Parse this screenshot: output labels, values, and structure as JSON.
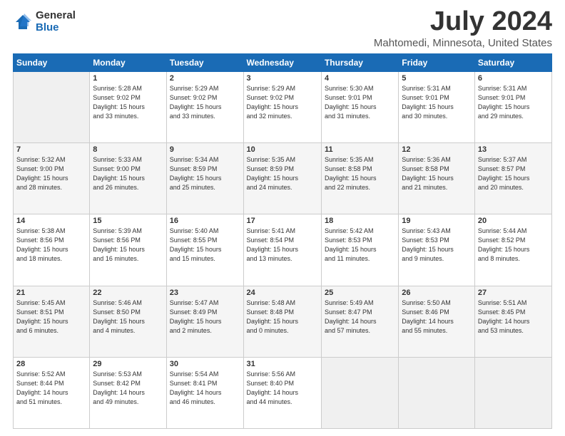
{
  "header": {
    "logo_general": "General",
    "logo_blue": "Blue",
    "month_title": "July 2024",
    "location": "Mahtomedi, Minnesota, United States"
  },
  "days_of_week": [
    "Sunday",
    "Monday",
    "Tuesday",
    "Wednesday",
    "Thursday",
    "Friday",
    "Saturday"
  ],
  "weeks": [
    [
      {
        "num": "",
        "info": ""
      },
      {
        "num": "1",
        "info": "Sunrise: 5:28 AM\nSunset: 9:02 PM\nDaylight: 15 hours\nand 33 minutes."
      },
      {
        "num": "2",
        "info": "Sunrise: 5:29 AM\nSunset: 9:02 PM\nDaylight: 15 hours\nand 33 minutes."
      },
      {
        "num": "3",
        "info": "Sunrise: 5:29 AM\nSunset: 9:02 PM\nDaylight: 15 hours\nand 32 minutes."
      },
      {
        "num": "4",
        "info": "Sunrise: 5:30 AM\nSunset: 9:01 PM\nDaylight: 15 hours\nand 31 minutes."
      },
      {
        "num": "5",
        "info": "Sunrise: 5:31 AM\nSunset: 9:01 PM\nDaylight: 15 hours\nand 30 minutes."
      },
      {
        "num": "6",
        "info": "Sunrise: 5:31 AM\nSunset: 9:01 PM\nDaylight: 15 hours\nand 29 minutes."
      }
    ],
    [
      {
        "num": "7",
        "info": "Sunrise: 5:32 AM\nSunset: 9:00 PM\nDaylight: 15 hours\nand 28 minutes."
      },
      {
        "num": "8",
        "info": "Sunrise: 5:33 AM\nSunset: 9:00 PM\nDaylight: 15 hours\nand 26 minutes."
      },
      {
        "num": "9",
        "info": "Sunrise: 5:34 AM\nSunset: 8:59 PM\nDaylight: 15 hours\nand 25 minutes."
      },
      {
        "num": "10",
        "info": "Sunrise: 5:35 AM\nSunset: 8:59 PM\nDaylight: 15 hours\nand 24 minutes."
      },
      {
        "num": "11",
        "info": "Sunrise: 5:35 AM\nSunset: 8:58 PM\nDaylight: 15 hours\nand 22 minutes."
      },
      {
        "num": "12",
        "info": "Sunrise: 5:36 AM\nSunset: 8:58 PM\nDaylight: 15 hours\nand 21 minutes."
      },
      {
        "num": "13",
        "info": "Sunrise: 5:37 AM\nSunset: 8:57 PM\nDaylight: 15 hours\nand 20 minutes."
      }
    ],
    [
      {
        "num": "14",
        "info": "Sunrise: 5:38 AM\nSunset: 8:56 PM\nDaylight: 15 hours\nand 18 minutes."
      },
      {
        "num": "15",
        "info": "Sunrise: 5:39 AM\nSunset: 8:56 PM\nDaylight: 15 hours\nand 16 minutes."
      },
      {
        "num": "16",
        "info": "Sunrise: 5:40 AM\nSunset: 8:55 PM\nDaylight: 15 hours\nand 15 minutes."
      },
      {
        "num": "17",
        "info": "Sunrise: 5:41 AM\nSunset: 8:54 PM\nDaylight: 15 hours\nand 13 minutes."
      },
      {
        "num": "18",
        "info": "Sunrise: 5:42 AM\nSunset: 8:53 PM\nDaylight: 15 hours\nand 11 minutes."
      },
      {
        "num": "19",
        "info": "Sunrise: 5:43 AM\nSunset: 8:53 PM\nDaylight: 15 hours\nand 9 minutes."
      },
      {
        "num": "20",
        "info": "Sunrise: 5:44 AM\nSunset: 8:52 PM\nDaylight: 15 hours\nand 8 minutes."
      }
    ],
    [
      {
        "num": "21",
        "info": "Sunrise: 5:45 AM\nSunset: 8:51 PM\nDaylight: 15 hours\nand 6 minutes."
      },
      {
        "num": "22",
        "info": "Sunrise: 5:46 AM\nSunset: 8:50 PM\nDaylight: 15 hours\nand 4 minutes."
      },
      {
        "num": "23",
        "info": "Sunrise: 5:47 AM\nSunset: 8:49 PM\nDaylight: 15 hours\nand 2 minutes."
      },
      {
        "num": "24",
        "info": "Sunrise: 5:48 AM\nSunset: 8:48 PM\nDaylight: 15 hours\nand 0 minutes."
      },
      {
        "num": "25",
        "info": "Sunrise: 5:49 AM\nSunset: 8:47 PM\nDaylight: 14 hours\nand 57 minutes."
      },
      {
        "num": "26",
        "info": "Sunrise: 5:50 AM\nSunset: 8:46 PM\nDaylight: 14 hours\nand 55 minutes."
      },
      {
        "num": "27",
        "info": "Sunrise: 5:51 AM\nSunset: 8:45 PM\nDaylight: 14 hours\nand 53 minutes."
      }
    ],
    [
      {
        "num": "28",
        "info": "Sunrise: 5:52 AM\nSunset: 8:44 PM\nDaylight: 14 hours\nand 51 minutes."
      },
      {
        "num": "29",
        "info": "Sunrise: 5:53 AM\nSunset: 8:42 PM\nDaylight: 14 hours\nand 49 minutes."
      },
      {
        "num": "30",
        "info": "Sunrise: 5:54 AM\nSunset: 8:41 PM\nDaylight: 14 hours\nand 46 minutes."
      },
      {
        "num": "31",
        "info": "Sunrise: 5:56 AM\nSunset: 8:40 PM\nDaylight: 14 hours\nand 44 minutes."
      },
      {
        "num": "",
        "info": ""
      },
      {
        "num": "",
        "info": ""
      },
      {
        "num": "",
        "info": ""
      }
    ]
  ]
}
